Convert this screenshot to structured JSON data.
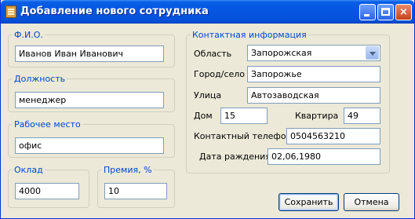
{
  "window": {
    "title": "Добавление нового сотрудника",
    "buttons": {
      "minimize": "minimize",
      "maximize": "maximize",
      "close": "×"
    }
  },
  "fio": {
    "legend": "Ф.И.О.",
    "value": "Иванов Иван Иванович"
  },
  "position": {
    "legend": "Должность",
    "value": "менеджер"
  },
  "workplace": {
    "legend": "Рабочее место",
    "value": "офис"
  },
  "salary": {
    "legend": "Оклад",
    "value": "4000"
  },
  "bonus": {
    "legend": "Премия, %",
    "value": "10"
  },
  "contact": {
    "legend": "Контактная информация",
    "region_label": "Область",
    "region_value": "Запорожская",
    "city_label": "Город/село",
    "city_value": "Запорожье",
    "street_label": "Улица",
    "street_value": "Автозаводская",
    "house_label": "Дом",
    "house_value": "15",
    "apt_label": "Квартира",
    "apt_value": "49",
    "phone_label": "Контактный телефон",
    "phone_value": "0504563210",
    "birth_label": "Дата раждения",
    "birth_value": "02,06,1980"
  },
  "actions": {
    "save": "Сохранить",
    "cancel": "Отмена"
  },
  "icons": {
    "app": "document-icon",
    "dropdown": "chevron-down-icon"
  }
}
